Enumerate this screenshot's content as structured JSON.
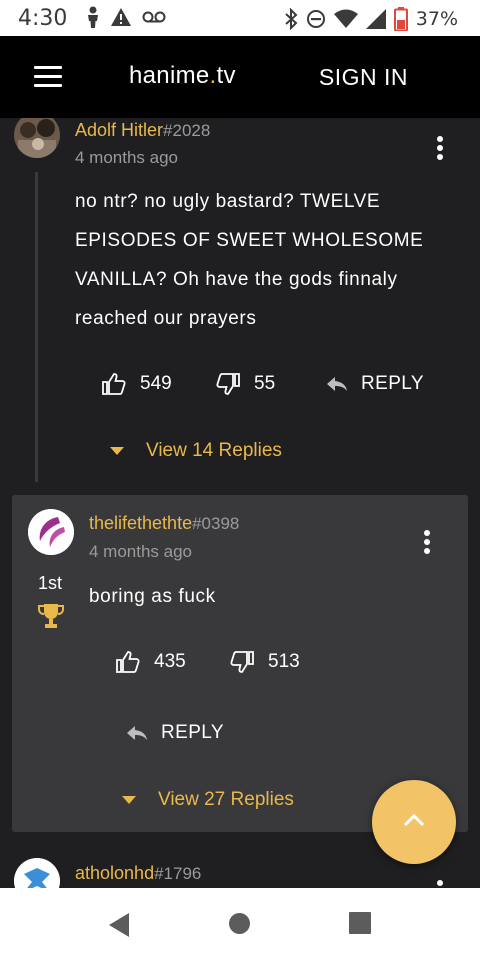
{
  "status_bar": {
    "time": "4:30",
    "battery_percent": "37%",
    "icons_left": [
      "person-icon",
      "warning-icon",
      "voicemail-icon"
    ],
    "icons_right": [
      "bluetooth-icon",
      "do-not-disturb-icon",
      "wifi-icon",
      "signal-icon",
      "battery-icon"
    ]
  },
  "app_bar": {
    "title_main": "hanime",
    "title_dot": ".",
    "title_suffix": "tv",
    "sign_in": "SIGN IN"
  },
  "comments": [
    {
      "username": "Adolf Hitler",
      "tag": "#2028",
      "time_ago": "4 months ago",
      "text_lines": [
        "no ntr? no ugly bastard? TWELVE",
        "EPISODES OF SWEET WHOLESOME",
        "VANILLA? Oh have the gods finnaly",
        "reached our prayers"
      ],
      "upvotes": "549",
      "downvotes": "55",
      "reply_label": "REPLY",
      "view_replies": "View 14 Replies"
    },
    {
      "username": "thelifethethte",
      "tag": "#0398",
      "time_ago": "4 months ago",
      "rank": "1st",
      "text": "boring as fuck",
      "upvotes": "435",
      "downvotes": "513",
      "reply_label": "REPLY",
      "view_replies": "View 27 Replies"
    },
    {
      "username": "atholonhd",
      "tag": "#1796"
    }
  ],
  "colors": {
    "accent": "#e8b84b",
    "fab": "#f3c467",
    "card": "#39393b",
    "background": "#1f1f21"
  }
}
